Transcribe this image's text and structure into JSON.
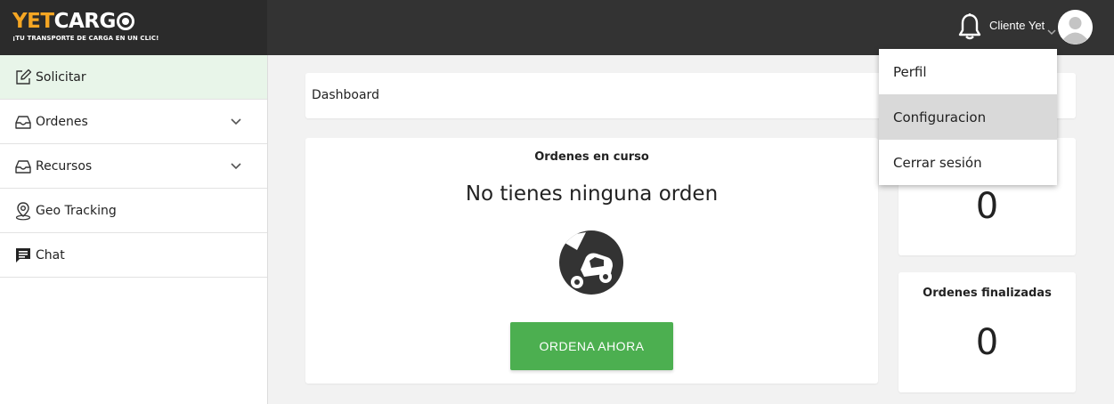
{
  "brand": {
    "name_part1": "YET",
    "name_part2": "CARG",
    "tagline": "¡TU TRANSPORTE DE CARGA EN UN CLIC!",
    "accent_color": "#f5a623"
  },
  "header": {
    "notification_icon": "bell-icon",
    "user_name": "Cliente Yet",
    "user_menu_icon": "chevron-down-icon",
    "avatar_icon": "user-avatar-icon"
  },
  "user_menu": {
    "items": [
      {
        "label": "Perfil"
      },
      {
        "label": "Configuracion",
        "hovered": true
      },
      {
        "label": "Cerrar sesión"
      }
    ]
  },
  "sidebar": {
    "items": [
      {
        "label": "Solicitar",
        "icon": "edit-icon",
        "active": true
      },
      {
        "label": "Ordenes",
        "icon": "inbox-icon",
        "expandable": true
      },
      {
        "label": "Recursos",
        "icon": "inbox-icon",
        "expandable": true
      },
      {
        "label": "Geo Tracking",
        "icon": "map-pin-icon"
      },
      {
        "label": "Chat",
        "icon": "chat-icon"
      }
    ],
    "active_color": "#e8f5e9"
  },
  "breadcrumb": {
    "label": "Dashboard"
  },
  "orders_in_progress": {
    "title": "Ordenes en curso",
    "empty_message": "No tienes ninguna orden",
    "empty_icon": "overturned-car-icon",
    "cta_label": "ORDENA AHORA",
    "cta_color": "#4caf50"
  },
  "stats": [
    {
      "title": "",
      "value": "0"
    },
    {
      "title": "Ordenes finalizadas",
      "value": "0"
    }
  ]
}
